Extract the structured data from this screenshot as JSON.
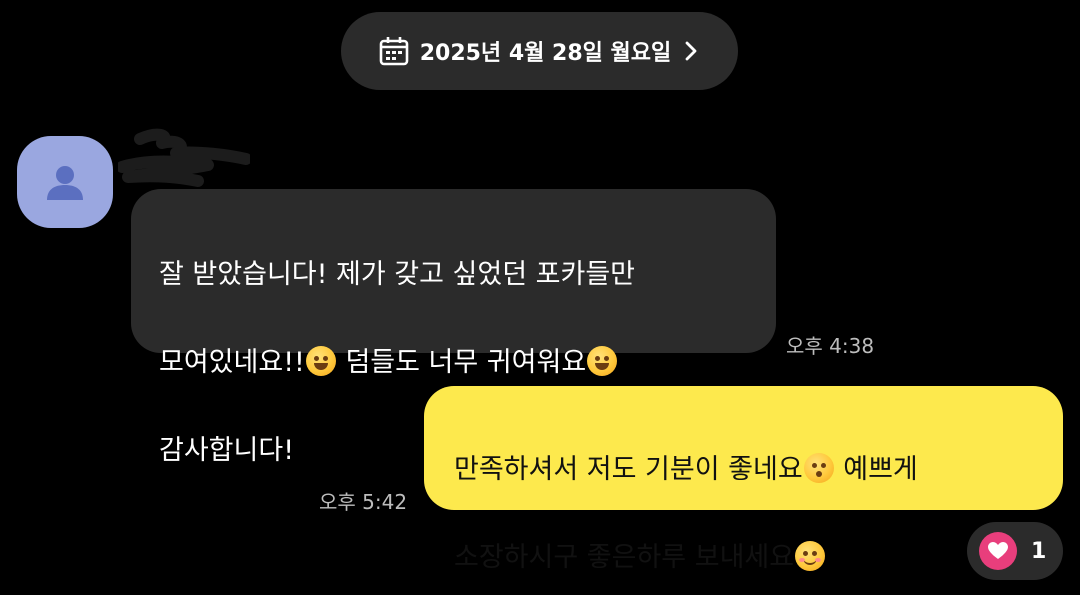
{
  "date_header": {
    "label": "2025년 4월 28일 월요일",
    "icon": "calendar-icon"
  },
  "messages": [
    {
      "direction": "incoming",
      "lines": [
        "잘 받았습니다! 제가 갖고 싶었던 포카들만",
        "모여있네요!!",
        " 덤들도 너무 귀여워요",
        "감사합니다!"
      ],
      "emojis": [
        "grinning-emoji",
        "laughing-emoji"
      ],
      "time": "오후 4:38"
    },
    {
      "direction": "outgoing",
      "lines": [
        "만족하셔서 저도 기분이 좋네요",
        " 예쁘게",
        "소장하시구 좋은하루 보내세요"
      ],
      "emojis": [
        "kissing-emoji",
        "smiling-emoji"
      ],
      "time": "오후 5:42"
    }
  ],
  "reaction": {
    "icon": "heart-icon",
    "count": "1"
  },
  "colors": {
    "background": "#000000",
    "incoming_bubble": "#2b2b2b",
    "outgoing_bubble": "#fde94d",
    "avatar": "#9aa7e0",
    "heart": "#e83e7c"
  }
}
